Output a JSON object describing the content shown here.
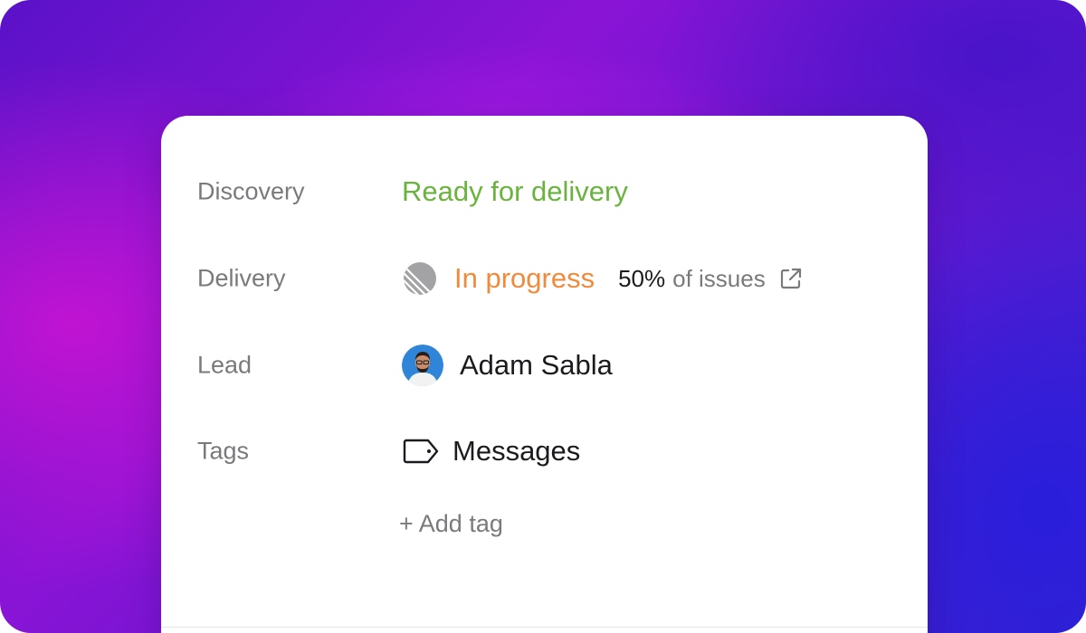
{
  "fields": {
    "discovery": {
      "label": "Discovery",
      "value": "Ready for delivery",
      "value_color": "#6ab33e"
    },
    "delivery": {
      "label": "Delivery",
      "status_icon": "progress-circle-icon",
      "status": "In progress",
      "status_color": "#f08a3c",
      "percent": "50%",
      "percent_suffix": "of issues",
      "progress_fraction": 0.5,
      "link_icon": "external-link-icon"
    },
    "lead": {
      "label": "Lead",
      "avatar": "avatar",
      "name": "Adam Sabla"
    },
    "tags": {
      "label": "Tags",
      "tag_icon": "tag-icon",
      "items": [
        "Messages"
      ],
      "add_label": "+ Add tag"
    }
  },
  "colors": {
    "background_magenta": "#c41ef0",
    "background_blue": "#3422cf",
    "card": "#ffffff",
    "label": "#7a7a7e"
  }
}
